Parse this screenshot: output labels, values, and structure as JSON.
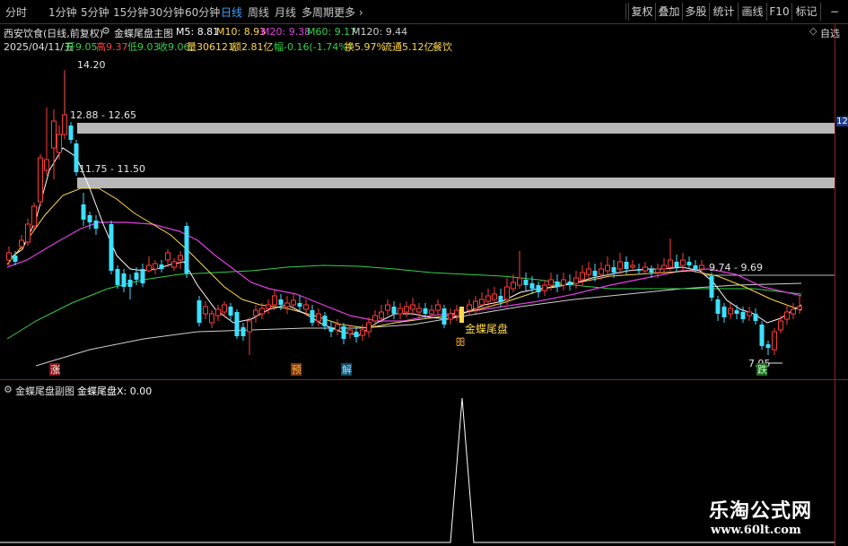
{
  "toolbar": {
    "periods": [
      "分时",
      "1分钟",
      "5分钟",
      "15分钟",
      "30分钟",
      "60分钟",
      "日线",
      "周线",
      "月线",
      "多周期",
      "更多"
    ],
    "active_period": "日线",
    "right_buttons": [
      "复权",
      "叠加",
      "多股",
      "统计",
      "画线",
      "F10",
      "标记"
    ],
    "minus": "−"
  },
  "stock": {
    "name": "西安饮食(日线,前复权)",
    "indicator": "金蝶尾盘主图",
    "m5": "M5: 8.81",
    "m10": "M10: 8.93",
    "m20": "M20: 9.38",
    "m60": "M60: 9.17",
    "m120": "M120: 9.44",
    "date": "2025/04/11/五",
    "open": "开9.05",
    "high": "高9.37",
    "low": "低9.03",
    "close": "收9.06",
    "volume": "量306121",
    "amount": "额2.81亿",
    "change": "幅-0.16(-1.74%)",
    "turnover": "换5.97%",
    "float": "流通5.12亿",
    "sector": "餐饮",
    "auto": "自选"
  },
  "annotations": {
    "peak": "14.20",
    "zone1": "12.88 - 12.65",
    "zone2": "11.75 - 11.50",
    "zone3": "9.74 - 9.69",
    "low": "7.95",
    "signal": "金蝶尾盘",
    "tag_zhang": "涨",
    "tag_yu": "预",
    "tag_jie": "解",
    "tag_die": "跌",
    "scale_mark": "12"
  },
  "sub": {
    "title": "金蝶尾盘副图",
    "value": "金蝶尾盘X: 0.00"
  },
  "watermark": {
    "name": "乐淘公式网",
    "url": "www.60lt.com"
  },
  "colors": {
    "up": "#ff3b3b",
    "down": "#3ce0ff",
    "m5": "#ffffff",
    "m10": "#ffd84a",
    "m20": "#e040e0",
    "m60": "#34d04a",
    "m120": "#cfcfcf",
    "zone": "#b8b8b8"
  }
}
